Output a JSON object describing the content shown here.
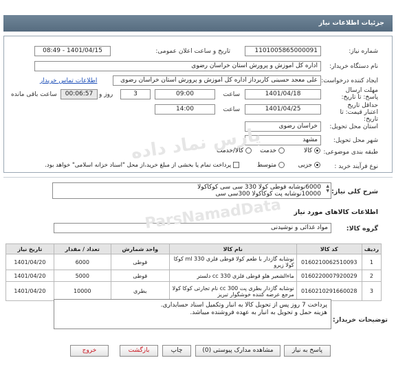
{
  "header": {
    "title": "جزئیات اطلاعات نیاز"
  },
  "need_number": {
    "label": "شماره نیاز:",
    "value": "1101005865000091"
  },
  "announce": {
    "label": "تاریخ و ساعت اعلان عمومی:",
    "value": "1401/04/15 - 08:49"
  },
  "buyer_org": {
    "label": "نام دستگاه خریدار:",
    "value": "اداره کل اموزش و پرورش استان خراسان رضوی"
  },
  "requester": {
    "label": "ایجاد کننده درخواست:",
    "value": "علی معجد حسینی کاربرداز اداره کل اموزش و پرورش استان خراسان رضوی",
    "contact_link": "اطلاعات تماس خریدار"
  },
  "deadline": {
    "label": "مهلت ارسال پاسخ: تا تاریخ:",
    "date": "1401/04/18",
    "time_label": "ساعت",
    "time": "09:00",
    "days": "3",
    "days_label": "روز و",
    "remaining": "00:06:57",
    "remaining_label": "ساعت باقی مانده"
  },
  "validity": {
    "label": "حداقل تاریخ اعتبار قیمت: تا تاریخ:",
    "date": "1401/04/25",
    "time_label": "ساعت",
    "time": "14:00"
  },
  "province": {
    "label": "استان محل تحویل:",
    "value": "خراسان رضوی"
  },
  "city": {
    "label": "شهر محل تحویل:",
    "value": "مشهد"
  },
  "category": {
    "label": "طبقه بندی موضوعی:",
    "options": [
      "کالا",
      "خدمت",
      "کالا/خدمت"
    ],
    "selected": "کالا"
  },
  "purchase": {
    "label": "نوع فرآیند خرید :",
    "options": [
      "جزیی",
      "متوسط"
    ],
    "selected": "جزیی",
    "treasury_note": "پرداخت تمام یا بخشی از مبلغ خرید،از محل \"اسناد خزانه اسلامی\" خواهد بود."
  },
  "description": {
    "label": "شرح کلی نیاز:",
    "line1": "6000نوشابه قوطی کولا 330 سی سی کوکاکولا",
    "line2": "10000نوشابه پت کوکاکولا 300سی سی"
  },
  "goods_title": "اطلاعات کالاهای مورد نیاز",
  "goods_group": {
    "label": "گروه کالا:",
    "value": "مواد غذائی و نوشیدنی"
  },
  "table": {
    "headers": [
      "ردیف",
      "کد کالا",
      "نام کالا",
      "واحد شمارش",
      "تعداد / مقدار",
      "تاریخ نیاز"
    ],
    "rows": [
      {
        "idx": "1",
        "code": "0160210062510093",
        "name": "نوشابه گازدار با طعم کولا قوطی فلزی ml 330 کوکا کولا زیرو",
        "unit": "قوطی",
        "qty": "6000",
        "date": "1401/04/20"
      },
      {
        "idx": "2",
        "code": "0160220007920029",
        "name": "ماءالشعیر هلو قوطی فلزی cc 330 دلستر",
        "unit": "قوطی",
        "qty": "5000",
        "date": "1401/04/20"
      },
      {
        "idx": "3",
        "code": "0160210291660028",
        "name": "نوشابه گازدار بطری پت cc 300 نام تجارتی کوکا کولا مرجع عرضه کننده خوشگوار تبریز",
        "unit": "بطری",
        "qty": "10000",
        "date": "1401/04/20"
      }
    ]
  },
  "buyer_notes": {
    "label": "توضیحات خریدار:",
    "line1": "پرداخت 7 روز پس از تحویل کالا به انبار وتکمیل اسناد حسابداری.",
    "line2": "هزینه حمل و تحویل به انبار به عهده فروشنده میباشد."
  },
  "buttons": {
    "reply": "پاسخ به نیاز",
    "attachments": "مشاهده مدارک پیوستی (0)",
    "print": "چاپ",
    "back": "بازگشت",
    "exit": "خروج"
  },
  "watermark": {
    "text1": "پارس نماد داده",
    "text2": "ParsNamadData"
  }
}
